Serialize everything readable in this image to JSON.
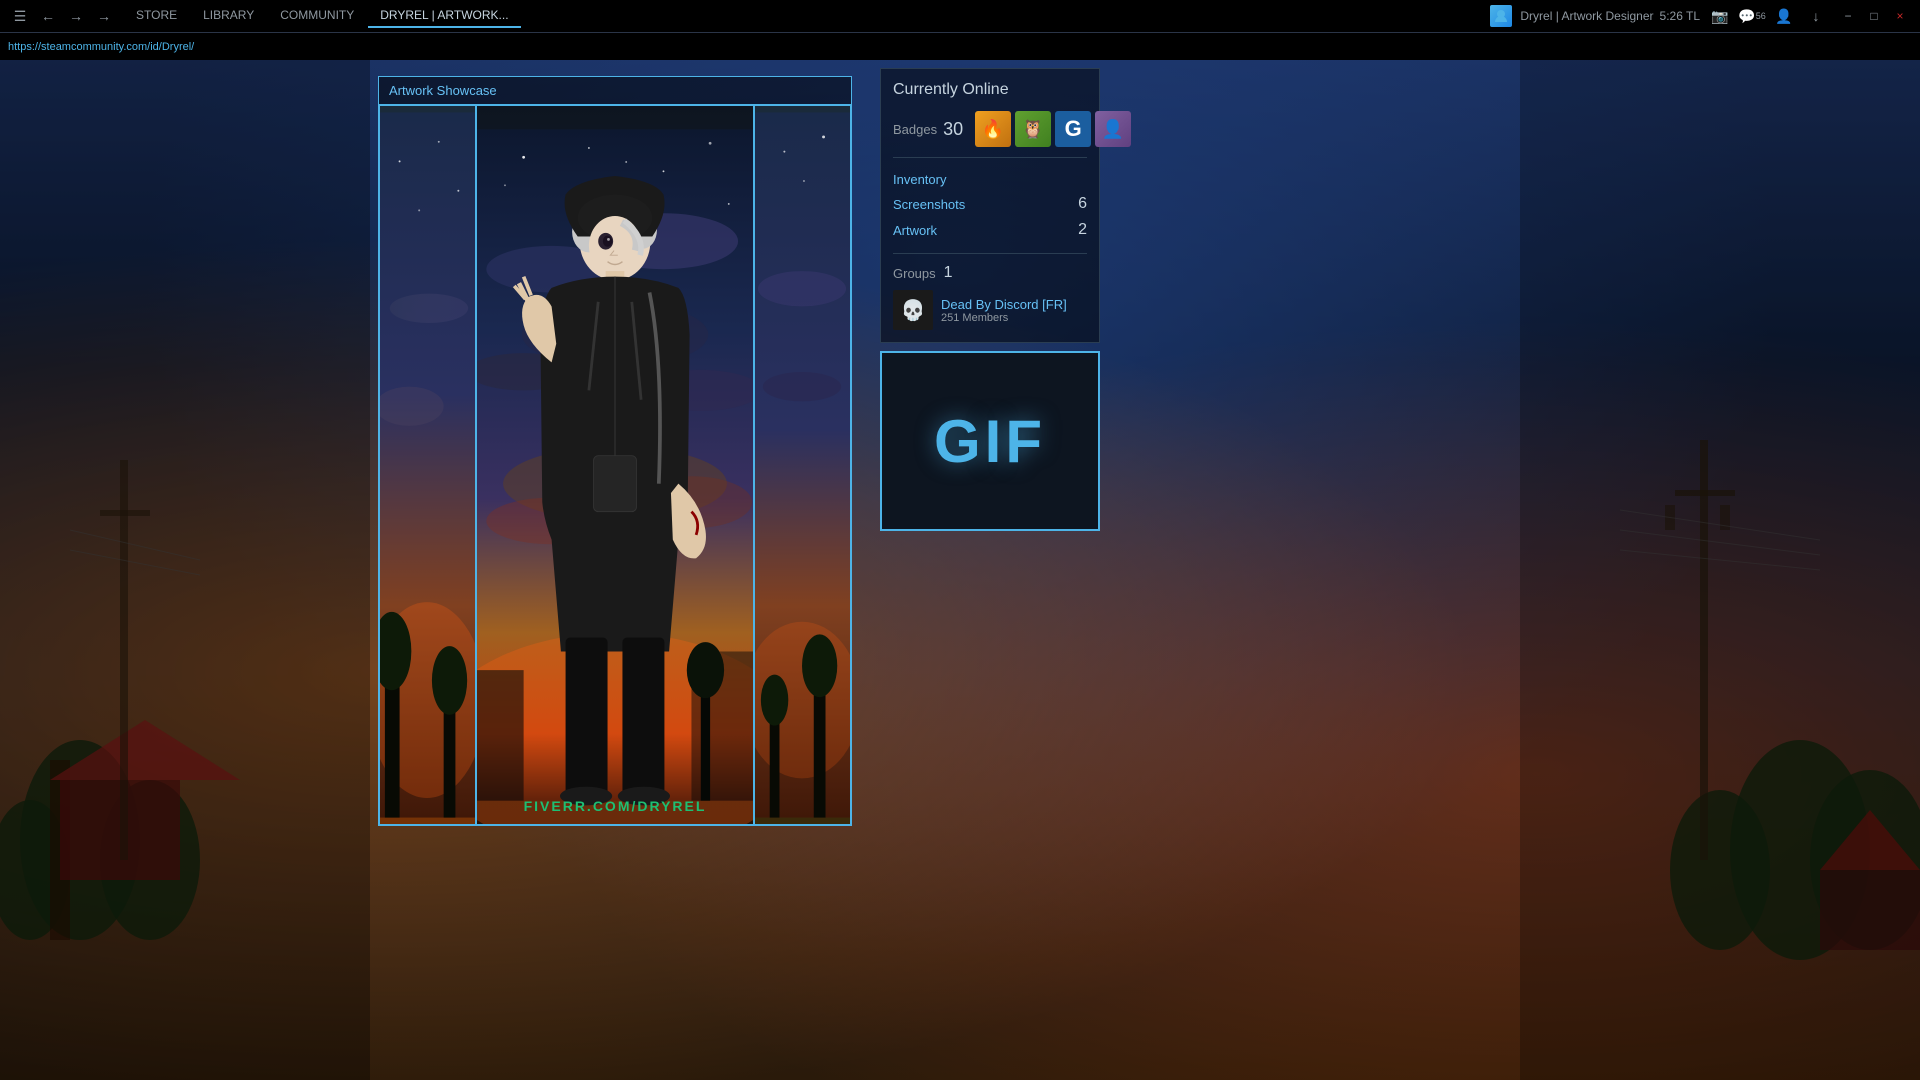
{
  "titlebar": {
    "tabs": [
      {
        "label": "STORE",
        "active": false
      },
      {
        "label": "LIBRARY",
        "active": false
      },
      {
        "label": "COMMUNITY",
        "active": false
      },
      {
        "label": "DRYREL | ARTWORK...",
        "active": true
      }
    ],
    "user": {
      "name": "Dryrel | Artwork Designer",
      "time": "5:26 TL",
      "avatar_icon": "steam-icon"
    },
    "notifications": "56",
    "window_controls": {
      "minimize": "−",
      "maximize": "□",
      "close": "×",
      "download": "↓"
    }
  },
  "addressbar": {
    "url": "https://steamcommunity.com/id/Dryrel/"
  },
  "profile": {
    "showcase_title": "Artwork Showcase",
    "status": "Currently Online",
    "badges": {
      "label": "Badges",
      "count": "30",
      "items": [
        {
          "type": "yellow-badge",
          "emoji": "🔥"
        },
        {
          "type": "owl-badge",
          "emoji": "🦉"
        },
        {
          "type": "g-badge",
          "text": "G"
        },
        {
          "type": "anime-badge",
          "emoji": "👤"
        }
      ]
    },
    "inventory": {
      "label": "Inventory",
      "link": true
    },
    "screenshots": {
      "label": "Screenshots",
      "count": "6"
    },
    "artwork": {
      "label": "Artwork",
      "count": "2"
    },
    "groups": {
      "label": "Groups",
      "count": "1",
      "items": [
        {
          "name": "Dead By Discord [FR]",
          "members": "251 Members",
          "icon": "💀"
        }
      ]
    },
    "gif_label": "GIF",
    "fiverr_text": "FIVERR.COM/",
    "fiverr_user": "DRYREL"
  }
}
